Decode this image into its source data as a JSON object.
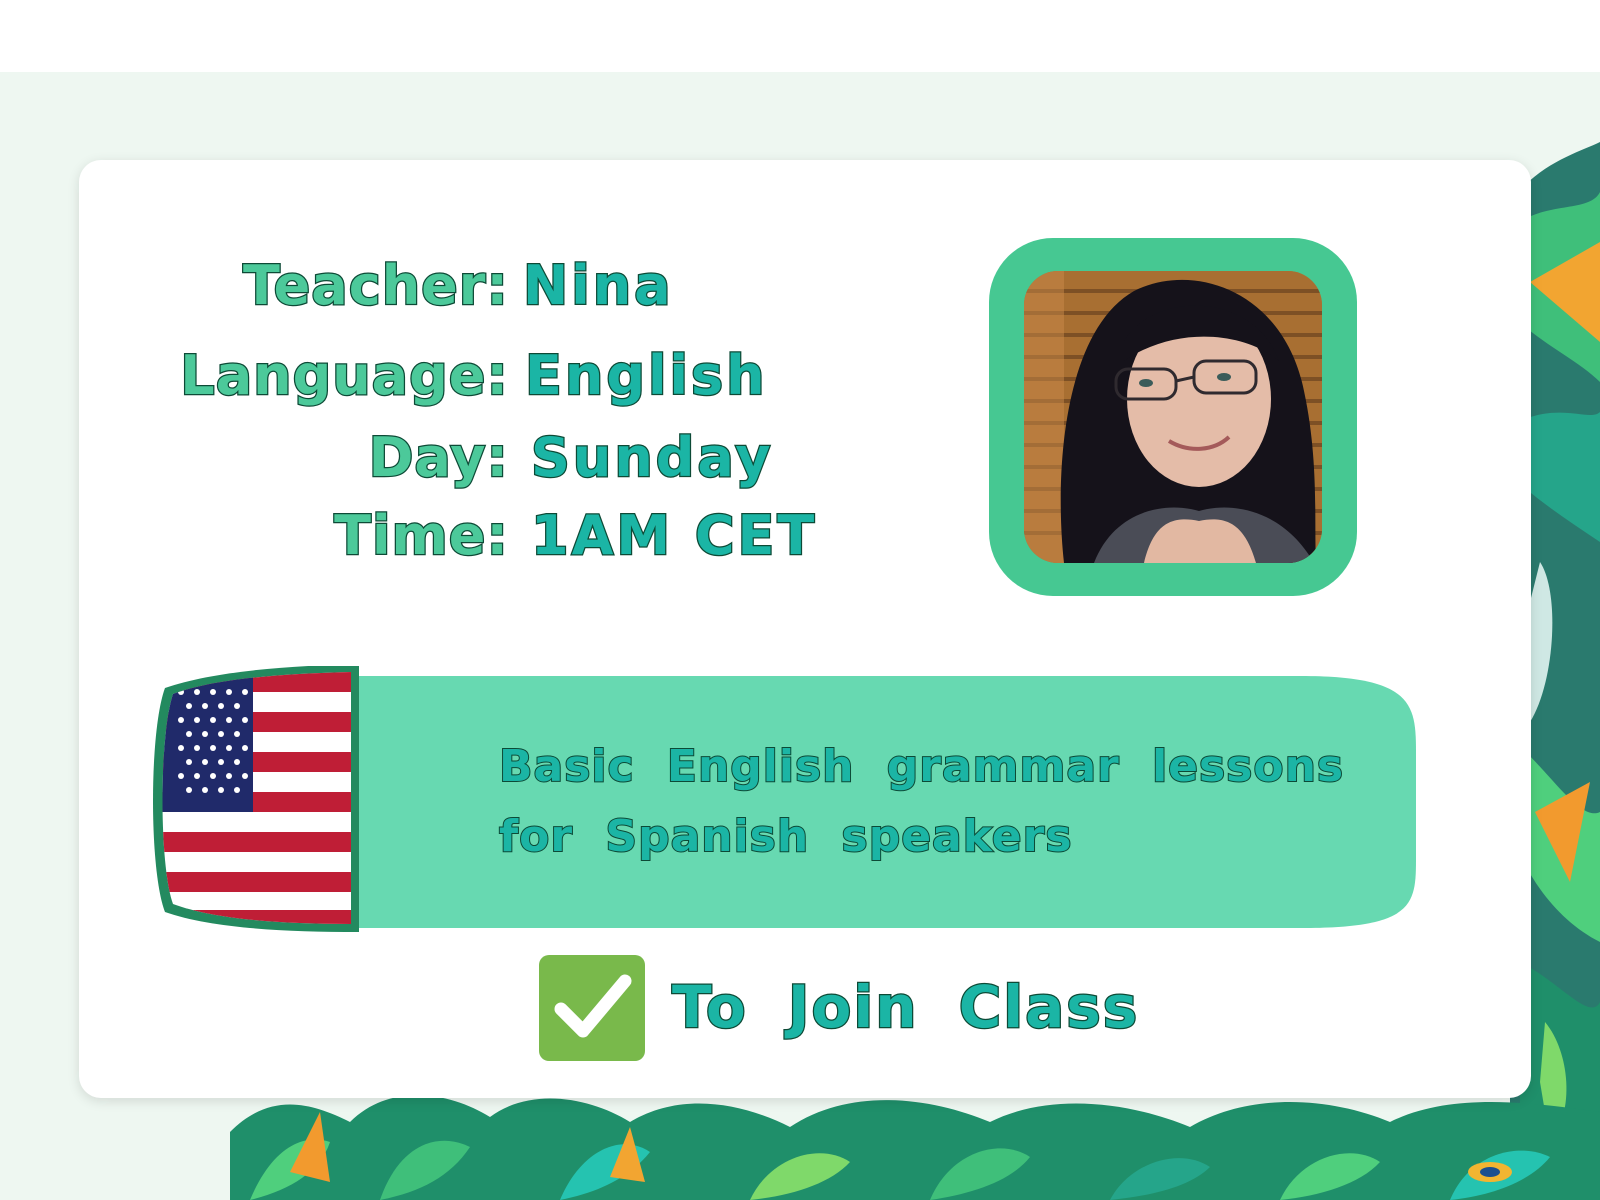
{
  "class_card": {
    "teacher_label": "Teacher:",
    "teacher_value": "Nina",
    "language_label": "Language:",
    "language_value": "English",
    "day_label": "Day:",
    "day_value": "Sunday",
    "time_label": "Time:",
    "time_value": "1AM CET",
    "description_line1": "Basic English grammar lessons",
    "description_line2": "for Spanish speakers",
    "join_label": "To Join Class"
  },
  "icons": {
    "teacher_photo": "teacher-photo",
    "flag": "us-flag-icon",
    "join": "check-mark-icon"
  },
  "colors": {
    "accent_green": "#46c892",
    "banner_green": "#67d9b1",
    "text_teal": "#1bb5a5",
    "outline": "#0d4a36",
    "check_green": "#79b94b"
  }
}
